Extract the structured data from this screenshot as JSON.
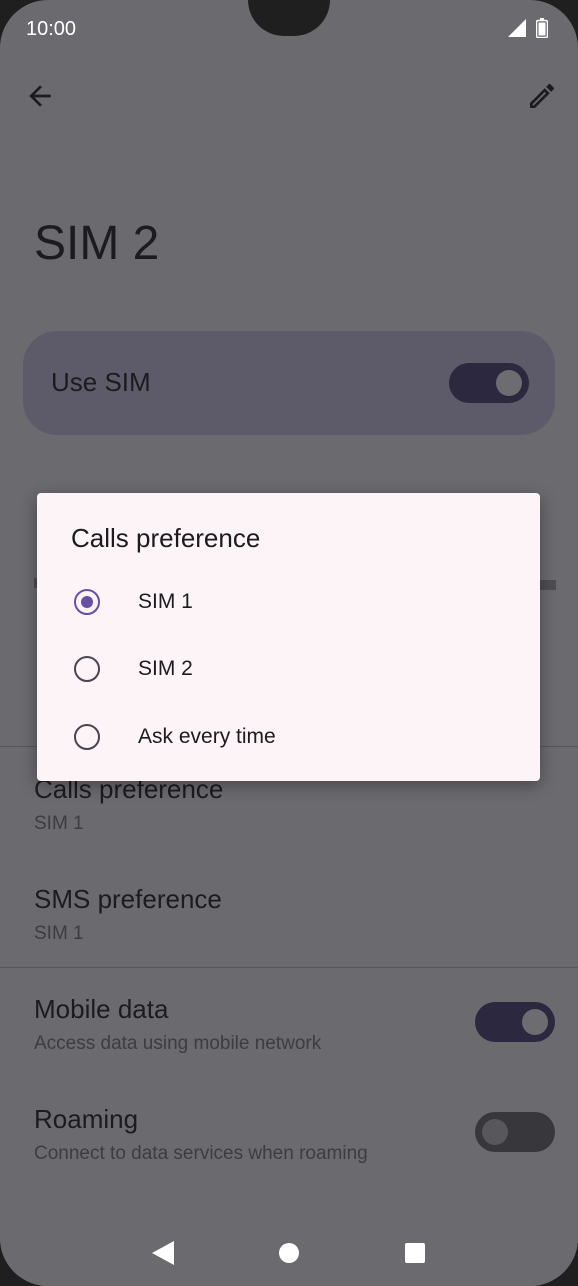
{
  "status_bar": {
    "time": "10:00"
  },
  "page": {
    "title": "SIM 2"
  },
  "use_sim": {
    "label": "Use SIM",
    "enabled": true
  },
  "settings": {
    "calls_preference": {
      "title": "Calls preference",
      "value": "SIM 1"
    },
    "sms_preference": {
      "title": "SMS preference",
      "value": "SIM 1"
    },
    "mobile_data": {
      "title": "Mobile data",
      "subtitle": "Access data using mobile network",
      "enabled": true
    },
    "roaming": {
      "title": "Roaming",
      "subtitle": "Connect to data services when roaming",
      "enabled": false
    }
  },
  "dialog": {
    "title": "Calls preference",
    "options": [
      {
        "label": "SIM 1",
        "selected": true
      },
      {
        "label": "SIM 2",
        "selected": false
      },
      {
        "label": "Ask every time",
        "selected": false
      }
    ]
  },
  "icons": {
    "back": "arrow-back-icon",
    "edit": "pencil-icon",
    "signal": "signal-icon",
    "battery": "battery-icon",
    "nav_back": "triangle-back-icon",
    "nav_home": "circle-home-icon",
    "nav_recents": "square-recents-icon"
  },
  "colors": {
    "scrim_background": "#6b6a6e",
    "dialog_background": "#fcf4f7",
    "radio_accent": "#6750a4",
    "toggle_on": "#2c2840"
  }
}
